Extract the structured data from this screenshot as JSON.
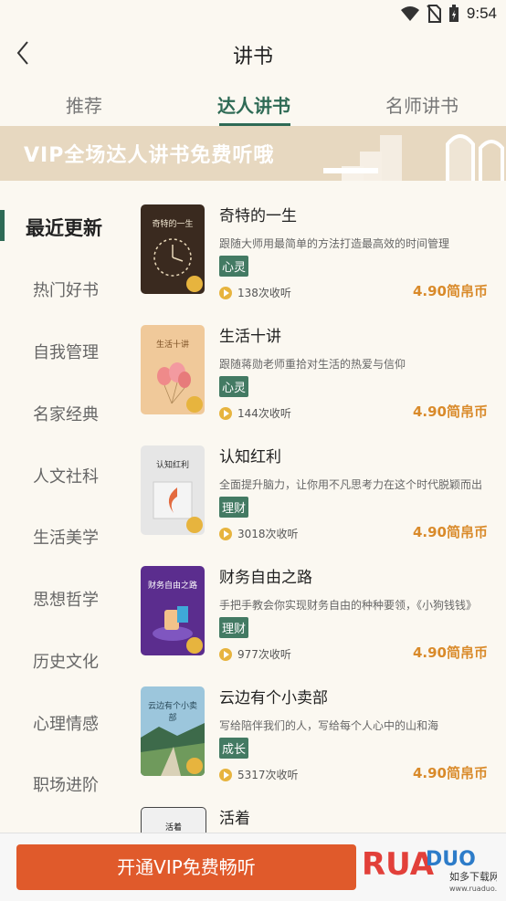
{
  "status": {
    "time": "9:54"
  },
  "header": {
    "title": "讲书"
  },
  "tabs": [
    {
      "label": "推荐"
    },
    {
      "label": "达人讲书"
    },
    {
      "label": "名师讲书"
    }
  ],
  "banner": {
    "text": "VIP全场达人讲书免费听哦"
  },
  "sidebar": {
    "items": [
      {
        "label": "最近更新"
      },
      {
        "label": "热门好书"
      },
      {
        "label": "自我管理"
      },
      {
        "label": "名家经典"
      },
      {
        "label": "人文社科"
      },
      {
        "label": "生活美学"
      },
      {
        "label": "思想哲学"
      },
      {
        "label": "历史文化"
      },
      {
        "label": "心理情感"
      },
      {
        "label": "职场进阶"
      }
    ]
  },
  "books": [
    {
      "title": "奇特的一生",
      "desc": "跟随大师用最简单的方法打造最高效的时间管理",
      "tag": "心灵",
      "listens": "138次收听",
      "price": "4.90简帛币",
      "cover_title": "奇特的一生"
    },
    {
      "title": "生活十讲",
      "desc": "跟随蒋勋老师重拾对生活的热爱与信仰",
      "tag": "心灵",
      "listens": "144次收听",
      "price": "4.90简帛币",
      "cover_title": "生活十讲"
    },
    {
      "title": "认知红利",
      "desc": "全面提升脑力，让你用不凡思考力在这个时代脱颖而出",
      "tag": "理财",
      "listens": "3018次收听",
      "price": "4.90简帛币",
      "cover_title": "认知红利"
    },
    {
      "title": "财务自由之路",
      "desc": "手把手教会你实现财务自由的种种要领，《小狗钱钱》",
      "tag": "理财",
      "listens": "977次收听",
      "price": "4.90简帛币",
      "cover_title": "财务自由之路"
    },
    {
      "title": "云边有个小卖部",
      "desc": "写给陪伴我们的人，写给每个人心中的山和海",
      "tag": "成长",
      "listens": "5317次收听",
      "price": "4.90简帛币",
      "cover_title": "云边有个小卖部"
    },
    {
      "title": "活着",
      "cover_title": "活着"
    }
  ],
  "bottom": {
    "button_label": "开通VIP免费畅听"
  },
  "watermark": {
    "brand": "RUANDUO",
    "sub": "如多下载网",
    "url": "www.ruaduo.com"
  },
  "colors": {
    "accent": "#2e6a55",
    "tag": "#437a63",
    "price": "#d98a2a",
    "vip_button": "#e05a2b",
    "banner": "#e7d8c0"
  }
}
